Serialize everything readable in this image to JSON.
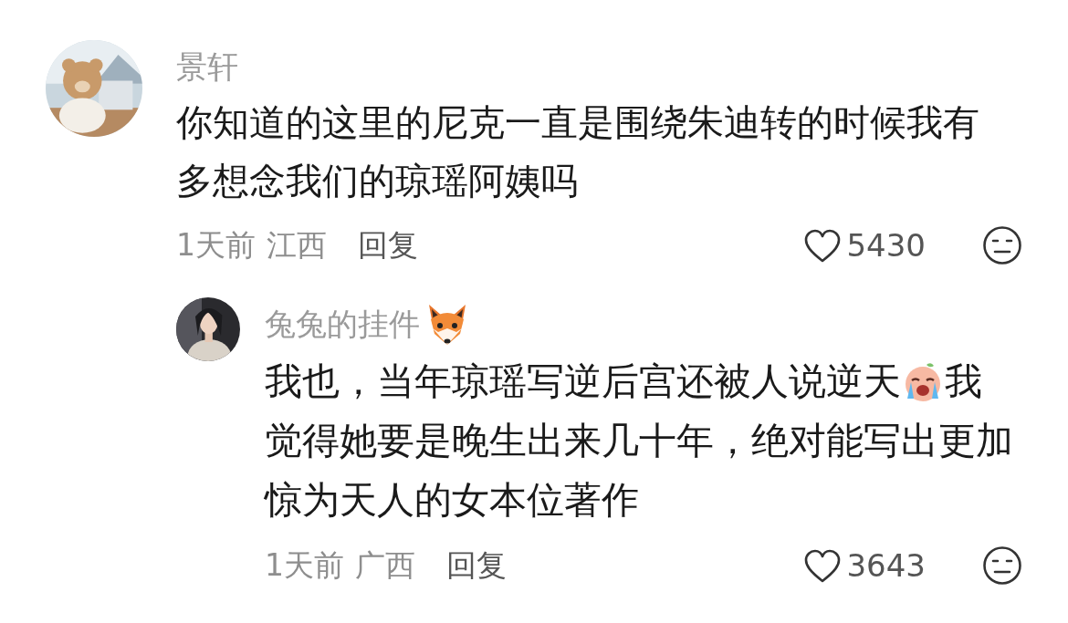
{
  "comments": [
    {
      "avatar": {
        "kind": "picture"
      },
      "name": "景轩",
      "has_badge": false,
      "lines": [
        [
          {
            "kind": "text",
            "value": "你知道的这里的尼克一直是围绕朱迪转的时候我有多想念我们的琼瑶阿姨吗"
          }
        ]
      ],
      "time": "1天前",
      "location": "江西",
      "reply": "回复",
      "likes": "5430",
      "reply_level": false
    },
    {
      "avatar": {
        "kind": "picture"
      },
      "name": "兔兔的挂件",
      "has_badge": true,
      "lines": [
        [
          {
            "kind": "text",
            "value": "我也，当年琼瑶写逆后宫还被人说逆天"
          },
          {
            "kind": "emoji"
          },
          {
            "kind": "text",
            "value": "我"
          }
        ],
        [
          {
            "kind": "text",
            "value": "觉得她要是晚生出来几十年，绝对能写出更加"
          }
        ],
        [
          {
            "kind": "text",
            "value": "惊为天人的女本位著作"
          }
        ]
      ],
      "time": "1天前",
      "location": "广西",
      "reply": "回复",
      "likes": "3643",
      "reply_level": true
    }
  ]
}
